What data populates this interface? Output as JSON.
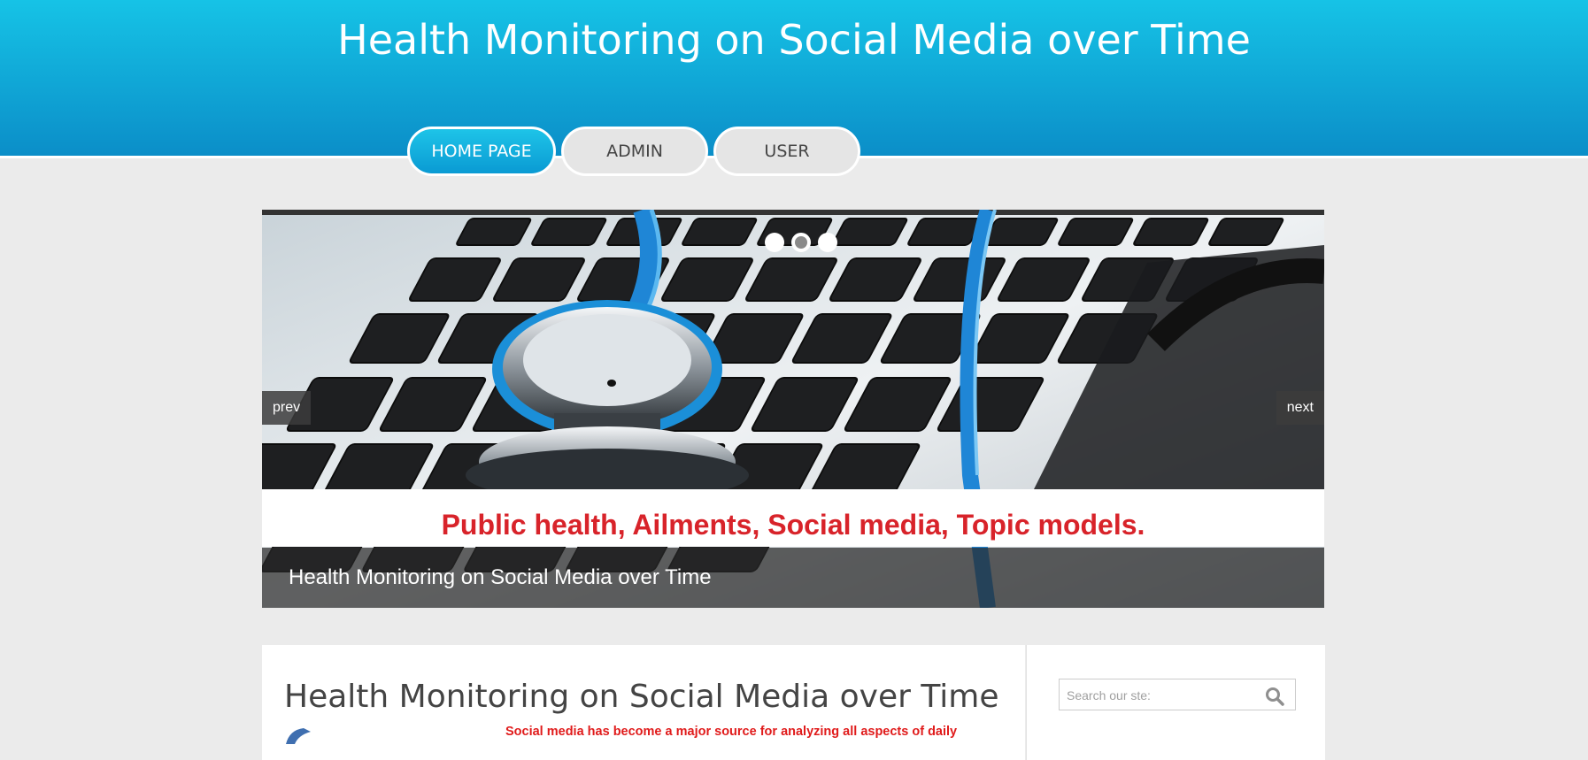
{
  "header": {
    "title": "Health Monitoring on Social Media over Time",
    "nav": [
      {
        "label": "HOME PAGE",
        "active": true
      },
      {
        "label": "ADMIN",
        "active": false
      },
      {
        "label": "USER",
        "active": false
      }
    ]
  },
  "slider": {
    "tagline": "Public health, Ailments, Social media, Topic models.",
    "caption": "Health Monitoring on Social Media over Time",
    "prev_label": "prev",
    "next_label": "next",
    "dot_count": 3,
    "active_dot": 2
  },
  "main": {
    "title": "Health Monitoring on Social Media over Time",
    "excerpt": "Social media has become a major source for analyzing all aspects of daily"
  },
  "sidebar": {
    "search_placeholder": "Search our ste:"
  },
  "colors": {
    "header_top": "#16c3e6",
    "header_bottom": "#0b8ec8",
    "tagline_red": "#d8232a",
    "excerpt_red": "#e01b1b"
  }
}
